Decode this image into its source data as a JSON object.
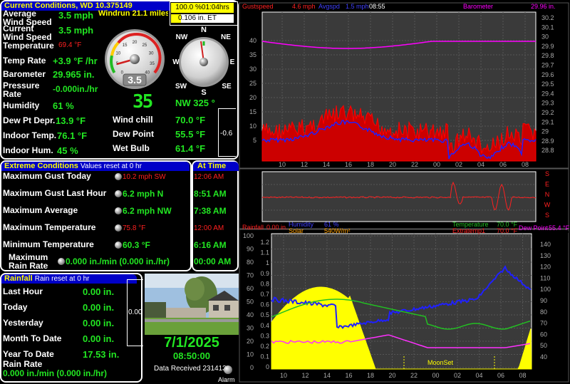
{
  "current": {
    "title": "Current Conditions, WD 10.375149",
    "avg_wind_label": "Average\nWind Speed",
    "avg_wind": "3.5 mph",
    "windrun": "Windrun 21.1 miles",
    "cur_wind_label": "Current\nWind Speed",
    "cur_wind": "3.5 mph",
    "temp_label": "Temperature",
    "temp": "69.4 °F",
    "temp_rate_label": "Temp Rate",
    "temp_rate": "+3.9 °F /hr",
    "baro_label": "Barometer",
    "baro": "29.965 in.",
    "press_rate_label": "Pressure\nRate",
    "press_rate": "-0.000in./hr",
    "humidity_label": "Humidity",
    "humidity": "61 %",
    "dewdepr_label": "Dew Pt Depr.",
    "dewdepr": "13.9 °F",
    "indoor_temp_label": "Indoor Temp.",
    "indoor_temp": "76.1 °F",
    "indoor_hum_label": "Indoor Hum.",
    "indoor_hum": "45 %",
    "windchill_label": "Wind chill",
    "windchill": "70.0 °F",
    "dewpoint_label": "Dew Point",
    "dewpoint": "55.5 °F",
    "wetbulb_label": "Wet Bulb",
    "wetbulb": "61.4 °F",
    "gauge_value": "3.5",
    "gauge_ticks": [
      "0",
      "5",
      "10",
      "15",
      "20",
      "25",
      "30",
      "35",
      "40"
    ],
    "compass": {
      "n": "N",
      "ne": "NE",
      "e": "E",
      "se": "SE",
      "s": "S",
      "sw": "SW",
      "w": "W",
      "nw": "NW"
    },
    "wind_dir_big": "35",
    "wind_dir": "NW  325 °",
    "et_top": "100.0 %01:04hrs",
    "et_bottom": "0.106 in. ET",
    "side_value": "-0.6"
  },
  "extreme": {
    "title": "Extreme Conditions",
    "subtitle": "Values reset at 0 hr",
    "at_time_title": "At Time",
    "rows": [
      {
        "label": "Maximum Gust Today",
        "value": "10.2 mph SW",
        "red": true,
        "time": "12:06 AM",
        "time_red": true
      },
      {
        "label": "Maximum Gust Last Hour",
        "value": "6.2 mph  N",
        "red": false,
        "time": "8:51 AM",
        "time_red": false
      },
      {
        "label": "Maximum Average",
        "value": "6.2 mph  NW",
        "red": false,
        "time": "7:38 AM",
        "time_red": false
      },
      {
        "label": "Maximum Temperature",
        "value": "75.8 °F",
        "red": true,
        "time": "12:00 AM",
        "time_red": true
      },
      {
        "label": "Minimum Temperature",
        "value": "60.3 °F",
        "red": false,
        "time": "6:16 AM",
        "time_red": false
      }
    ],
    "max_rain_label": "Maximum\nRain Rate",
    "max_rain_value": "0.000 in./min (0.000 in./hr)",
    "max_rain_time": "00:00 AM"
  },
  "rainfall": {
    "title": "Rainfall",
    "subtitle": "Rain reset at 0 hr",
    "last_hour_label": "Last Hour",
    "last_hour": "0.00 in.",
    "today_label": "Today",
    "today": "0.00 in.",
    "yesterday_label": "Yesterday",
    "yesterday": "0.00 in.",
    "month_label": "Month To Date",
    "month": "0.00 in.",
    "year_label": "Year To Date",
    "year": "17.53 in.",
    "rate_label": "Rain Rate",
    "rate": "0.000 in./min (0.000 in./hr)",
    "side_value": "0.00"
  },
  "footer": {
    "date": "7/1/2025",
    "time": "08:50:00",
    "data_received": "Data Received 231413",
    "alarm": "Alarm"
  },
  "graph1": {
    "gust_label": "Gustspeed",
    "gust_value": "4.6 mph",
    "avg_label": "Avgspd",
    "avg_value": "1.5 mph",
    "time": "08:55",
    "baro_label": "Barometer",
    "baro_value": "29.96 in.",
    "left_ticks": [
      "40",
      "35",
      "30",
      "25",
      "20",
      "15",
      "10",
      "5"
    ],
    "right_ticks": [
      "30.2",
      "30.1",
      "30",
      "29.9",
      "29.8",
      "29.7",
      "29.6",
      "29.5",
      "29.4",
      "29.3",
      "29.2",
      "29.1",
      "29",
      "28.9",
      "28.8"
    ],
    "x_ticks": [
      "10",
      "12",
      "14",
      "16",
      "18",
      "20",
      "22",
      "00",
      "02",
      "04",
      "06",
      "08"
    ]
  },
  "graph2": {
    "dirs": [
      "S",
      "E",
      "N",
      "W",
      "S"
    ]
  },
  "graph3": {
    "rain_label": "Rainfall",
    "rain_value": "0.00 in.",
    "hum_label": "Humidity",
    "hum_value": "61 %",
    "solar_label": "Solar",
    "solar_value": "540W/m²",
    "temp_label": "Temperature",
    "temp_value": "70.0 °F",
    "extra_label": "Extratemp1",
    "extra_value": "70.0 °F",
    "dew_label": "Dew Point",
    "dew_value": "55.4 °F",
    "moonset": "MoonSet",
    "left_ticks": [
      "100",
      "90",
      "80",
      "70",
      "60",
      "50",
      "40",
      "30",
      "20",
      "10",
      "0"
    ],
    "rain_ticks": [
      "1.2",
      "1.1",
      "1",
      "0.9",
      "0.8",
      "0.7",
      "0.6",
      "0.5",
      "0.4",
      "0.3",
      "0.2",
      "0.1",
      "0"
    ],
    "right_ticks": [
      "140",
      "130",
      "120",
      "110",
      "100",
      "90",
      "80",
      "70",
      "60",
      "50",
      "40"
    ],
    "x_ticks": [
      "10",
      "12",
      "14",
      "16",
      "18",
      "20",
      "22",
      "00",
      "02",
      "04",
      "06",
      "08"
    ]
  }
}
